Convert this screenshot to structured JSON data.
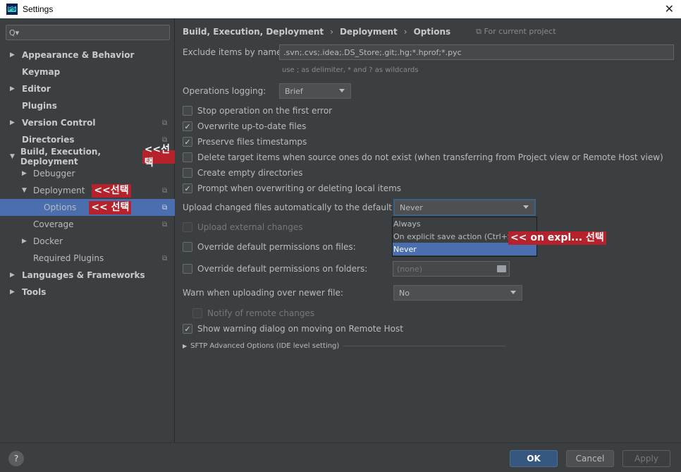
{
  "window": {
    "title": "Settings",
    "app_icon": "PS"
  },
  "sidebar": {
    "search_value": "Q▾",
    "items": [
      {
        "label": "Appearance & Behavior",
        "level": 0,
        "arrow": "▶",
        "bold": true
      },
      {
        "label": "Keymap",
        "level": 0,
        "arrow": "",
        "bold": true
      },
      {
        "label": "Editor",
        "level": 0,
        "arrow": "▶",
        "bold": true
      },
      {
        "label": "Plugins",
        "level": 0,
        "arrow": "",
        "bold": true
      },
      {
        "label": "Version Control",
        "level": 0,
        "arrow": "▶",
        "bold": true
      },
      {
        "label": "Directories",
        "level": 0,
        "arrow": "",
        "bold": true
      },
      {
        "label": "Build, Execution, Deployment",
        "level": 0,
        "arrow": "▼",
        "bold": true
      },
      {
        "label": "Debugger",
        "level": 1,
        "arrow": "▶"
      },
      {
        "label": "Deployment",
        "level": 1,
        "arrow": "▼"
      },
      {
        "label": "Options",
        "level": 2,
        "arrow": "",
        "selected": true
      },
      {
        "label": "Coverage",
        "level": 1,
        "arrow": ""
      },
      {
        "label": "Docker",
        "level": 1,
        "arrow": "▶"
      },
      {
        "label": "Required Plugins",
        "level": 1,
        "arrow": ""
      },
      {
        "label": "Languages & Frameworks",
        "level": 0,
        "arrow": "▶",
        "bold": true
      },
      {
        "label": "Tools",
        "level": 0,
        "arrow": "▶",
        "bold": true
      }
    ],
    "annotations": {
      "build": "<<선택",
      "deployment": "<<선택",
      "options": "<< 선택"
    }
  },
  "breadcrumb": {
    "parts": [
      "Build, Execution, Deployment",
      "Deployment",
      "Options"
    ],
    "separator": "›",
    "project_scope": "⧉ For current project"
  },
  "settings": {
    "exclude_label": "Exclude items by name:",
    "exclude_value": ".svn;.cvs;.idea;.DS_Store;.git;.hg;*.hprof;*.pyc",
    "exclude_hint": "use ; as delimiter, * and ? as wildcards",
    "ops_logging_label": "Operations logging:",
    "ops_logging_value": "Brief",
    "checkboxes": [
      {
        "label": "Stop operation on the first error",
        "checked": false
      },
      {
        "label": "Overwrite up-to-date files",
        "checked": true
      },
      {
        "label": "Preserve files timestamps",
        "checked": true
      },
      {
        "label": "Delete target items when source ones do not exist (when transferring from Project view or Remote Host view)",
        "checked": false
      },
      {
        "label": "Create empty directories",
        "checked": false
      },
      {
        "label": "Prompt when overwriting or deleting local items",
        "checked": true
      }
    ],
    "upload_label": "Upload changed files automatically to the default server",
    "upload_value": "Never",
    "upload_options": [
      "Always",
      "On explicit save action (Ctrl+S)",
      "Never"
    ],
    "upload_annotation": "<< on expl... 선택",
    "upload_external": "Upload external changes",
    "override_files": "Override default permissions on files:",
    "override_folders": "Override default permissions on folders:",
    "folders_value": "(none)",
    "warn_label": "Warn when uploading over newer file:",
    "warn_value": "No",
    "notify_remote": "Notify of remote changes",
    "show_warning": "Show warning dialog on moving on Remote Host",
    "sftp_advanced": "SFTP Advanced Options (IDE level setting)"
  },
  "buttons": {
    "help": "?",
    "ok": "OK",
    "cancel": "Cancel",
    "apply": "Apply"
  },
  "colors": {
    "selection": "#4b6eaf",
    "annotation": "#b5222c",
    "ok_button": "#365880"
  }
}
